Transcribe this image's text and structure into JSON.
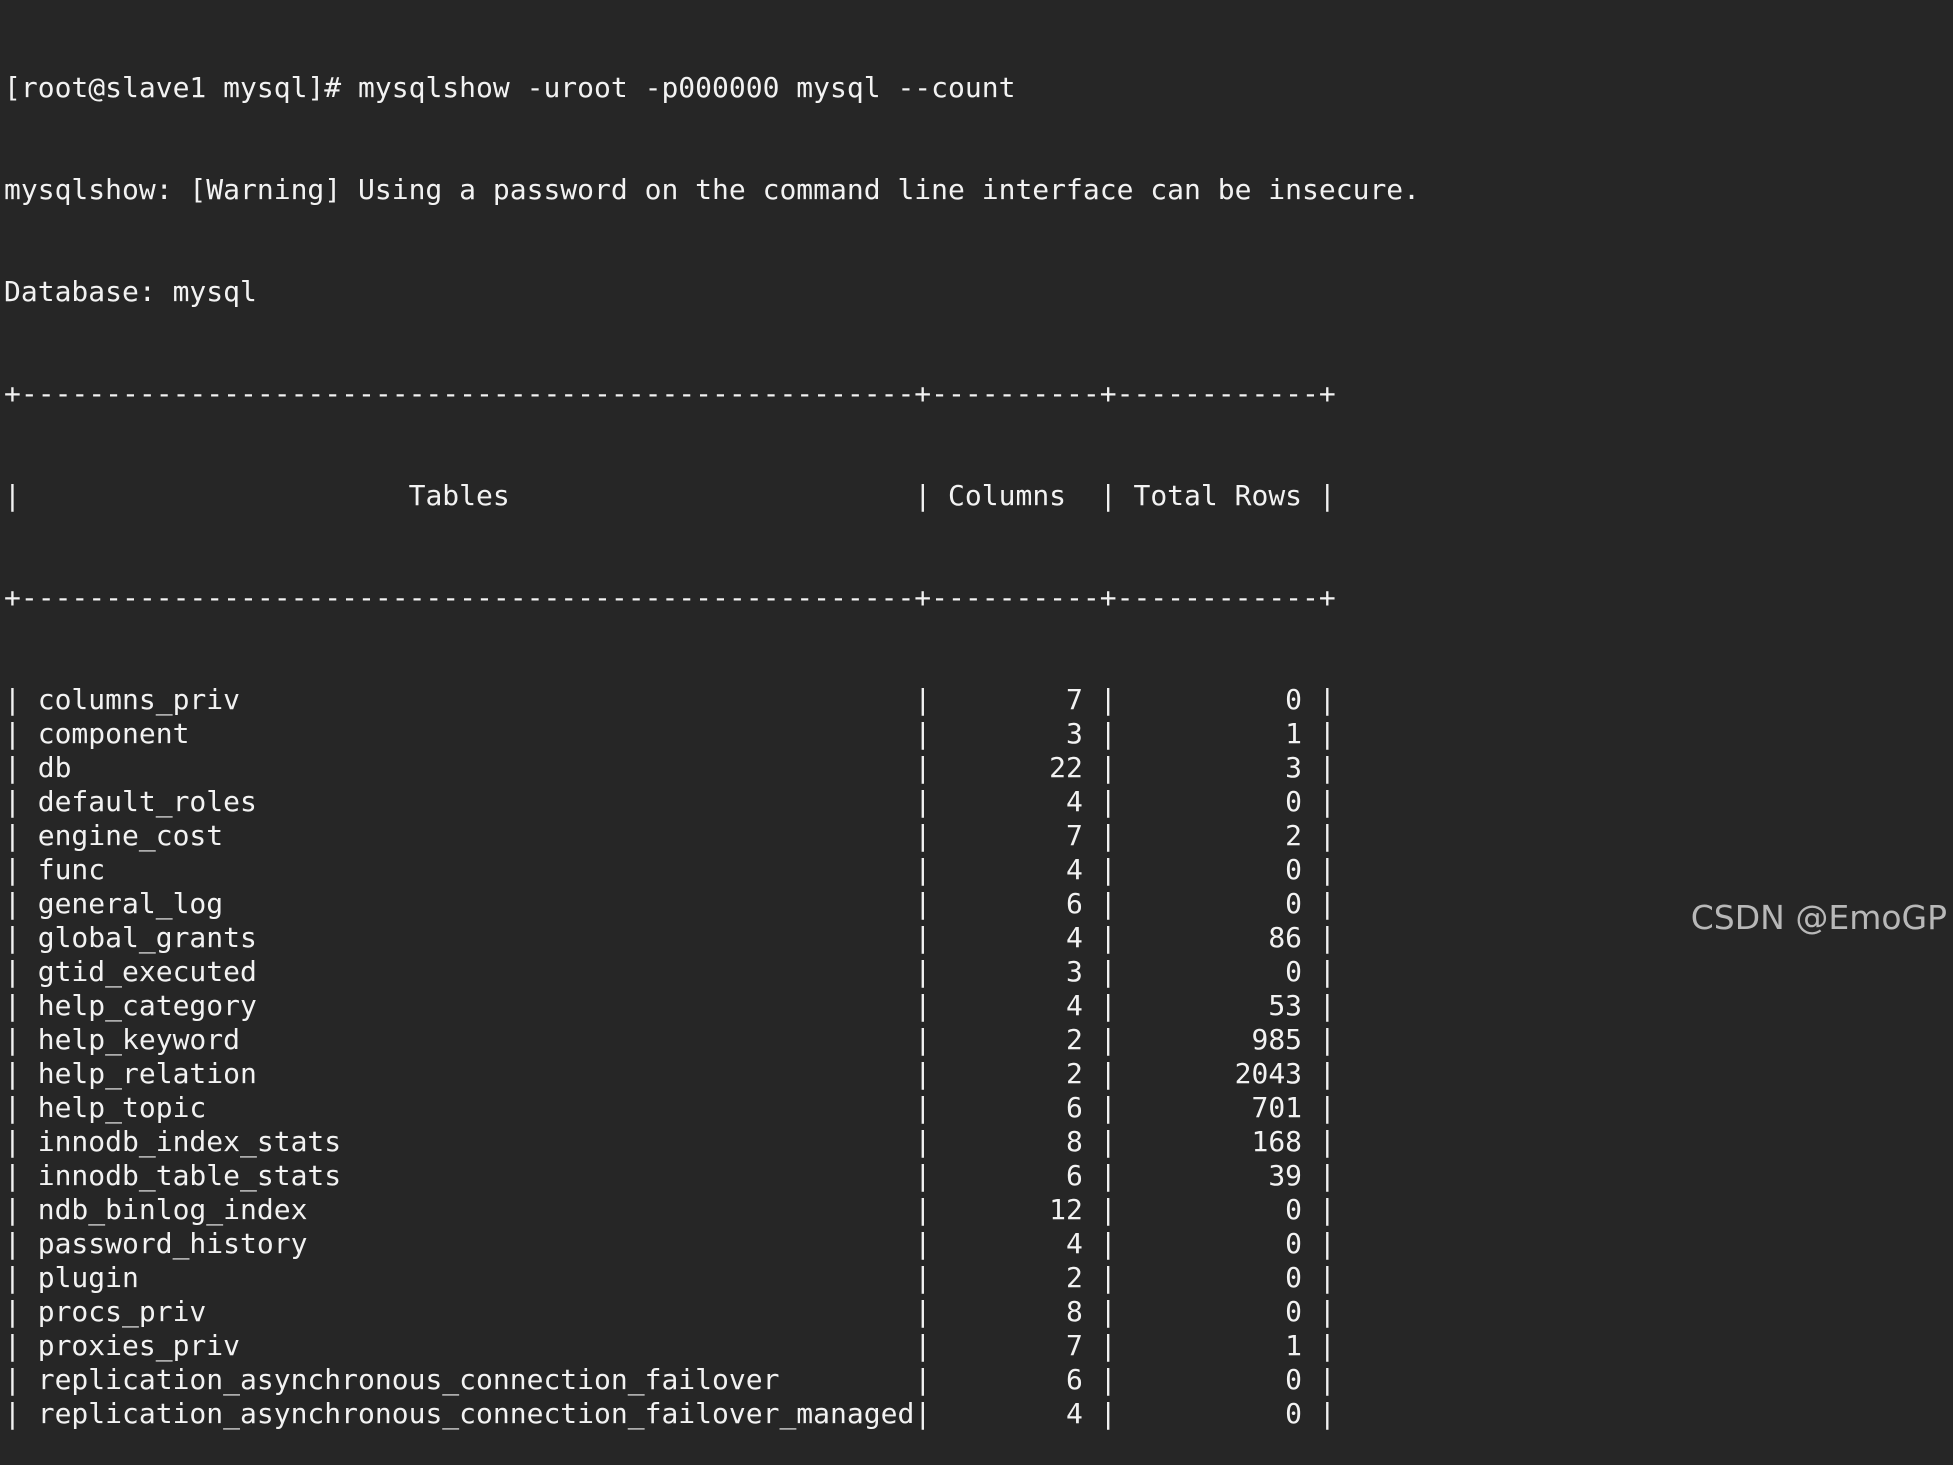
{
  "terminal": {
    "prompt": "[root@slave1 mysql]# ",
    "command": "mysqlshow -uroot -p000000 mysql --count",
    "warning": "mysqlshow: [Warning] Using a password on the command line interface can be insecure.",
    "database_label": "Database: ",
    "database_name": "mysql",
    "table": {
      "col_widths": [
        53,
        10,
        12
      ],
      "headers": [
        "Tables",
        "Columns",
        "Total Rows"
      ],
      "rows": [
        {
          "name": "columns_priv",
          "columns": "7",
          "total_rows": "0"
        },
        {
          "name": "component",
          "columns": "3",
          "total_rows": "1"
        },
        {
          "name": "db",
          "columns": "22",
          "total_rows": "3"
        },
        {
          "name": "default_roles",
          "columns": "4",
          "total_rows": "0"
        },
        {
          "name": "engine_cost",
          "columns": "7",
          "total_rows": "2"
        },
        {
          "name": "func",
          "columns": "4",
          "total_rows": "0"
        },
        {
          "name": "general_log",
          "columns": "6",
          "total_rows": "0"
        },
        {
          "name": "global_grants",
          "columns": "4",
          "total_rows": "86"
        },
        {
          "name": "gtid_executed",
          "columns": "3",
          "total_rows": "0"
        },
        {
          "name": "help_category",
          "columns": "4",
          "total_rows": "53"
        },
        {
          "name": "help_keyword",
          "columns": "2",
          "total_rows": "985"
        },
        {
          "name": "help_relation",
          "columns": "2",
          "total_rows": "2043"
        },
        {
          "name": "help_topic",
          "columns": "6",
          "total_rows": "701"
        },
        {
          "name": "innodb_index_stats",
          "columns": "8",
          "total_rows": "168"
        },
        {
          "name": "innodb_table_stats",
          "columns": "6",
          "total_rows": "39"
        },
        {
          "name": "ndb_binlog_index",
          "columns": "12",
          "total_rows": "0"
        },
        {
          "name": "password_history",
          "columns": "4",
          "total_rows": "0"
        },
        {
          "name": "plugin",
          "columns": "2",
          "total_rows": "0"
        },
        {
          "name": "procs_priv",
          "columns": "8",
          "total_rows": "0"
        },
        {
          "name": "proxies_priv",
          "columns": "7",
          "total_rows": "1"
        },
        {
          "name": "replication_asynchronous_connection_failover",
          "columns": "6",
          "total_rows": "0"
        },
        {
          "name": "replication_asynchronous_connection_failover_managed",
          "columns": "4",
          "total_rows": "0"
        }
      ]
    }
  },
  "watermark": "CSDN @EmoGP",
  "colors": {
    "background": "#262626",
    "foreground": "#f2f2f2",
    "watermark": "#b8b8b8"
  }
}
